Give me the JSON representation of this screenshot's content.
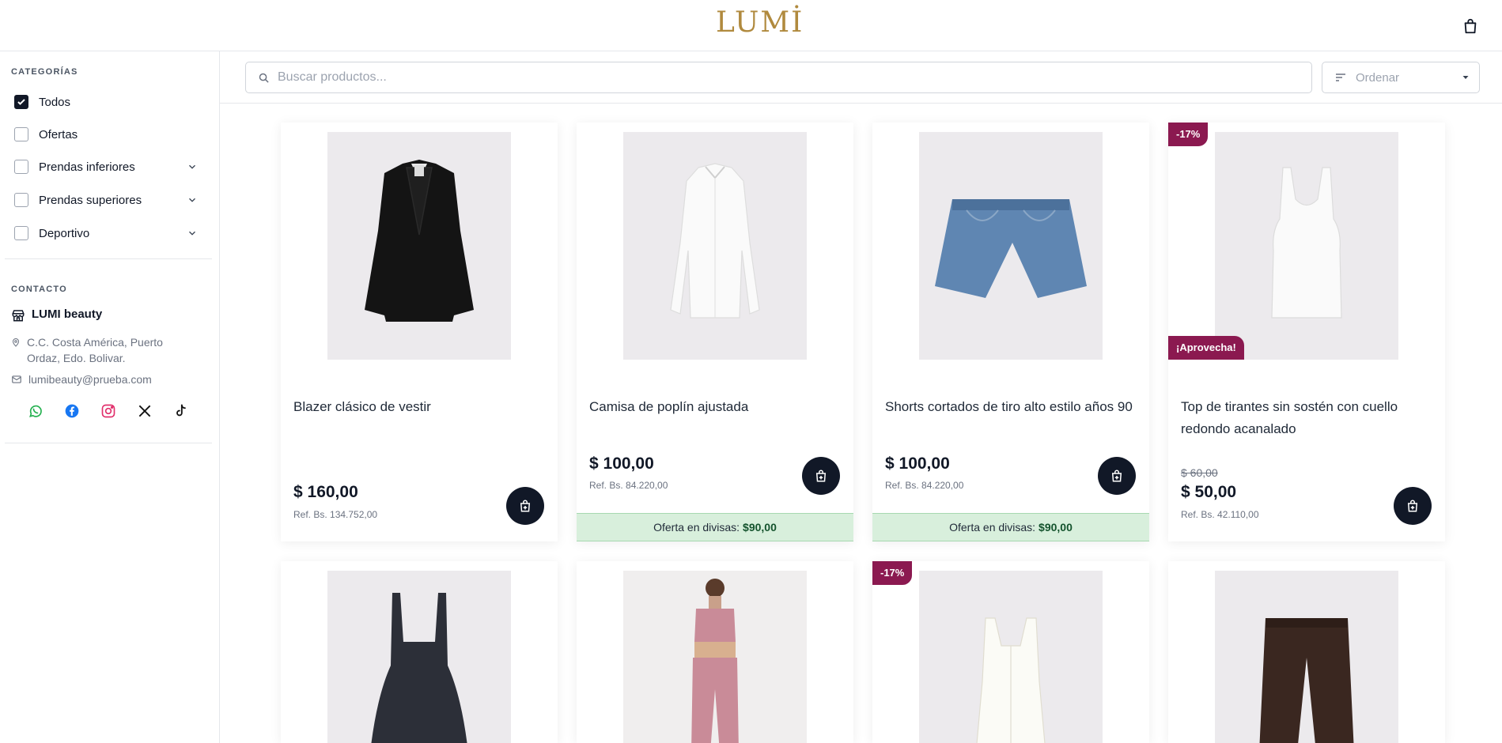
{
  "header": {
    "logo": "LUMİ",
    "cart_icon": "shopping-bag-icon"
  },
  "sidebar": {
    "categories_heading": "CATEGORÍAS",
    "categories": [
      {
        "label": "Todos",
        "checked": true,
        "expandable": false
      },
      {
        "label": "Ofertas",
        "checked": false,
        "expandable": false
      },
      {
        "label": "Prendas inferiores",
        "checked": false,
        "expandable": true
      },
      {
        "label": "Prendas superiores",
        "checked": false,
        "expandable": true
      },
      {
        "label": "Deportivo",
        "checked": false,
        "expandable": true
      }
    ],
    "contact_heading": "CONTACTO",
    "business_name": "LUMI beauty",
    "address_line1": "C.C. Costa América, Puerto",
    "address_line2": "Ordaz, Edo. Bolivar.",
    "email": "lumibeauty@prueba.com",
    "socials": [
      "whatsapp-icon",
      "facebook-icon",
      "instagram-icon",
      "x-icon",
      "tiktok-icon"
    ]
  },
  "search": {
    "placeholder": "Buscar productos...",
    "value": ""
  },
  "sort": {
    "label": "Ordenar"
  },
  "products": [
    {
      "name": "Blazer clásico de vestir",
      "old_price": "",
      "price": "$ 160,00",
      "ref": "Ref. Bs. 134.752,00",
      "offer_label": "",
      "offer_value": "",
      "badge": "",
      "promo": ""
    },
    {
      "name": "Camisa de poplín ajustada",
      "old_price": "",
      "price": "$ 100,00",
      "ref": "Ref. Bs. 84.220,00",
      "offer_label": "Oferta en divisas:",
      "offer_value": "$90,00",
      "badge": "",
      "promo": ""
    },
    {
      "name": "Shorts cortados de tiro alto estilo años 90",
      "old_price": "",
      "price": "$ 100,00",
      "ref": "Ref. Bs. 84.220,00",
      "offer_label": "Oferta en divisas:",
      "offer_value": "$90,00",
      "badge": "",
      "promo": ""
    },
    {
      "name": "Top de tirantes sin sostén con cuello redondo acanalado",
      "old_price": "$ 60,00",
      "price": "$ 50,00",
      "ref": "Ref. Bs. 42.110,00",
      "offer_label": "",
      "offer_value": "",
      "badge": "-17%",
      "promo": "¡Aprovecha!"
    },
    {
      "badge": ""
    },
    {
      "badge": ""
    },
    {
      "badge": "-17%"
    },
    {
      "badge": ""
    }
  ],
  "colors": {
    "accent": "#8b1950",
    "dark": "#111827",
    "offer_bg": "#d8efdc",
    "logo": "#b08a3e"
  }
}
